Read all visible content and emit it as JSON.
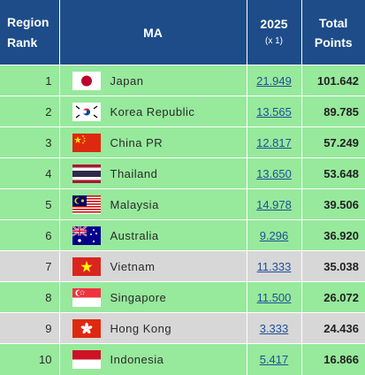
{
  "header": {
    "rank_line1": "Region",
    "rank_line2": "Rank",
    "ma": "MA",
    "y2025": "2025",
    "y2025_sub": "(x 1)",
    "total_line1": "Total",
    "total_line2": "Points"
  },
  "colors": {
    "header_bg": "#1d4c89",
    "row_green": "#97e99c",
    "row_grey": "#d7d7d7",
    "link": "#1f4f97"
  },
  "rows": [
    {
      "rank": "1",
      "flag": "japan-flag-icon",
      "name": "Japan",
      "y2025": "21.949",
      "total": "101.642"
    },
    {
      "rank": "2",
      "flag": "korea-flag-icon",
      "name": "Korea Republic",
      "y2025": "13.565",
      "total": "89.785"
    },
    {
      "rank": "3",
      "flag": "china-flag-icon",
      "name": "China PR",
      "y2025": "12.817",
      "total": "57.249"
    },
    {
      "rank": "4",
      "flag": "thailand-flag-icon",
      "name": "Thailand",
      "y2025": "13.650",
      "total": "53.648"
    },
    {
      "rank": "5",
      "flag": "malaysia-flag-icon",
      "name": "Malaysia",
      "y2025": "14.978",
      "total": "39.506"
    },
    {
      "rank": "6",
      "flag": "australia-flag-icon",
      "name": "Australia",
      "y2025": "9.296",
      "total": "36.920"
    },
    {
      "rank": "7",
      "flag": "vietnam-flag-icon",
      "name": "Vietnam",
      "y2025": "11.333",
      "total": "35.038"
    },
    {
      "rank": "8",
      "flag": "singapore-flag-icon",
      "name": "Singapore",
      "y2025": "11.500",
      "total": "26.072"
    },
    {
      "rank": "9",
      "flag": "hong-kong-flag-icon",
      "name": "Hong Kong",
      "y2025": "3.333",
      "total": "24.436"
    },
    {
      "rank": "10",
      "flag": "indonesia-flag-icon",
      "name": "Indonesia",
      "y2025": "5.417",
      "total": "16.866"
    }
  ]
}
